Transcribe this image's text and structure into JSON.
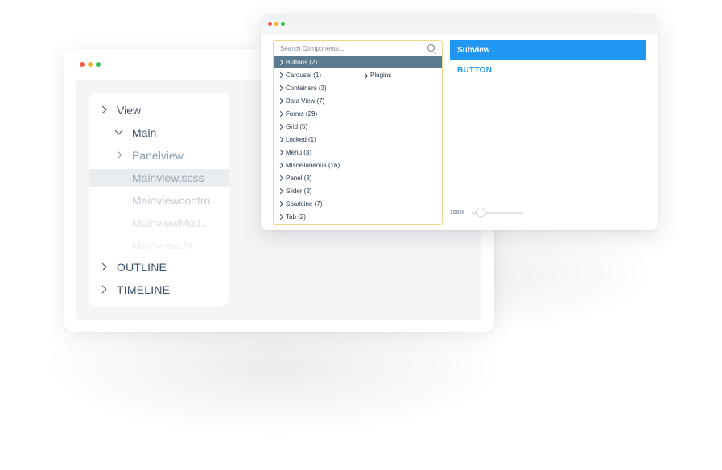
{
  "colors": {
    "dot_red": "#f2594e",
    "dot_yellow": "#f6b12a",
    "dot_green": "#2fc14b",
    "accent_blue": "#2196f3",
    "selected_row": "#5a7a8e"
  },
  "explorer": {
    "items": [
      {
        "label": "View",
        "icon": "chevron-right-icon"
      },
      {
        "label": "Main",
        "icon": "chevron-down-icon"
      },
      {
        "label": "Panelview",
        "icon": "chevron-right-icon"
      },
      {
        "label": "Mainview.scss"
      },
      {
        "label": "Mainviewcontro.."
      },
      {
        "label": "MainviewMod.."
      },
      {
        "label": "Mainview.Js"
      }
    ],
    "sections": [
      {
        "label": "OUTLINE",
        "icon": "chevron-right-icon"
      },
      {
        "label": "TIMELINE",
        "icon": "chevron-right-icon"
      }
    ]
  },
  "components": {
    "search_placeholder": "Search Components...",
    "items": [
      {
        "label": "Buttons (2)"
      },
      {
        "label": "Carousal (1)"
      },
      {
        "label": "Containers (3)"
      },
      {
        "label": "Data View (7)"
      },
      {
        "label": "Forms (29)"
      },
      {
        "label": "Grid (5)"
      },
      {
        "label": "Locked (1)"
      },
      {
        "label": "Menu (3)"
      },
      {
        "label": "Miscellaneous (16)"
      },
      {
        "label": "Panel (3)"
      },
      {
        "label": "Slider (2)"
      },
      {
        "label": "Sparkline (7)"
      },
      {
        "label": "Tab (2)"
      }
    ],
    "sub_items": [
      {
        "label": "Plugins"
      }
    ]
  },
  "preview": {
    "subview_label": "Subview",
    "button_label": "BUTTON",
    "zoom_label": "100%",
    "zoom_level": 0.0
  }
}
